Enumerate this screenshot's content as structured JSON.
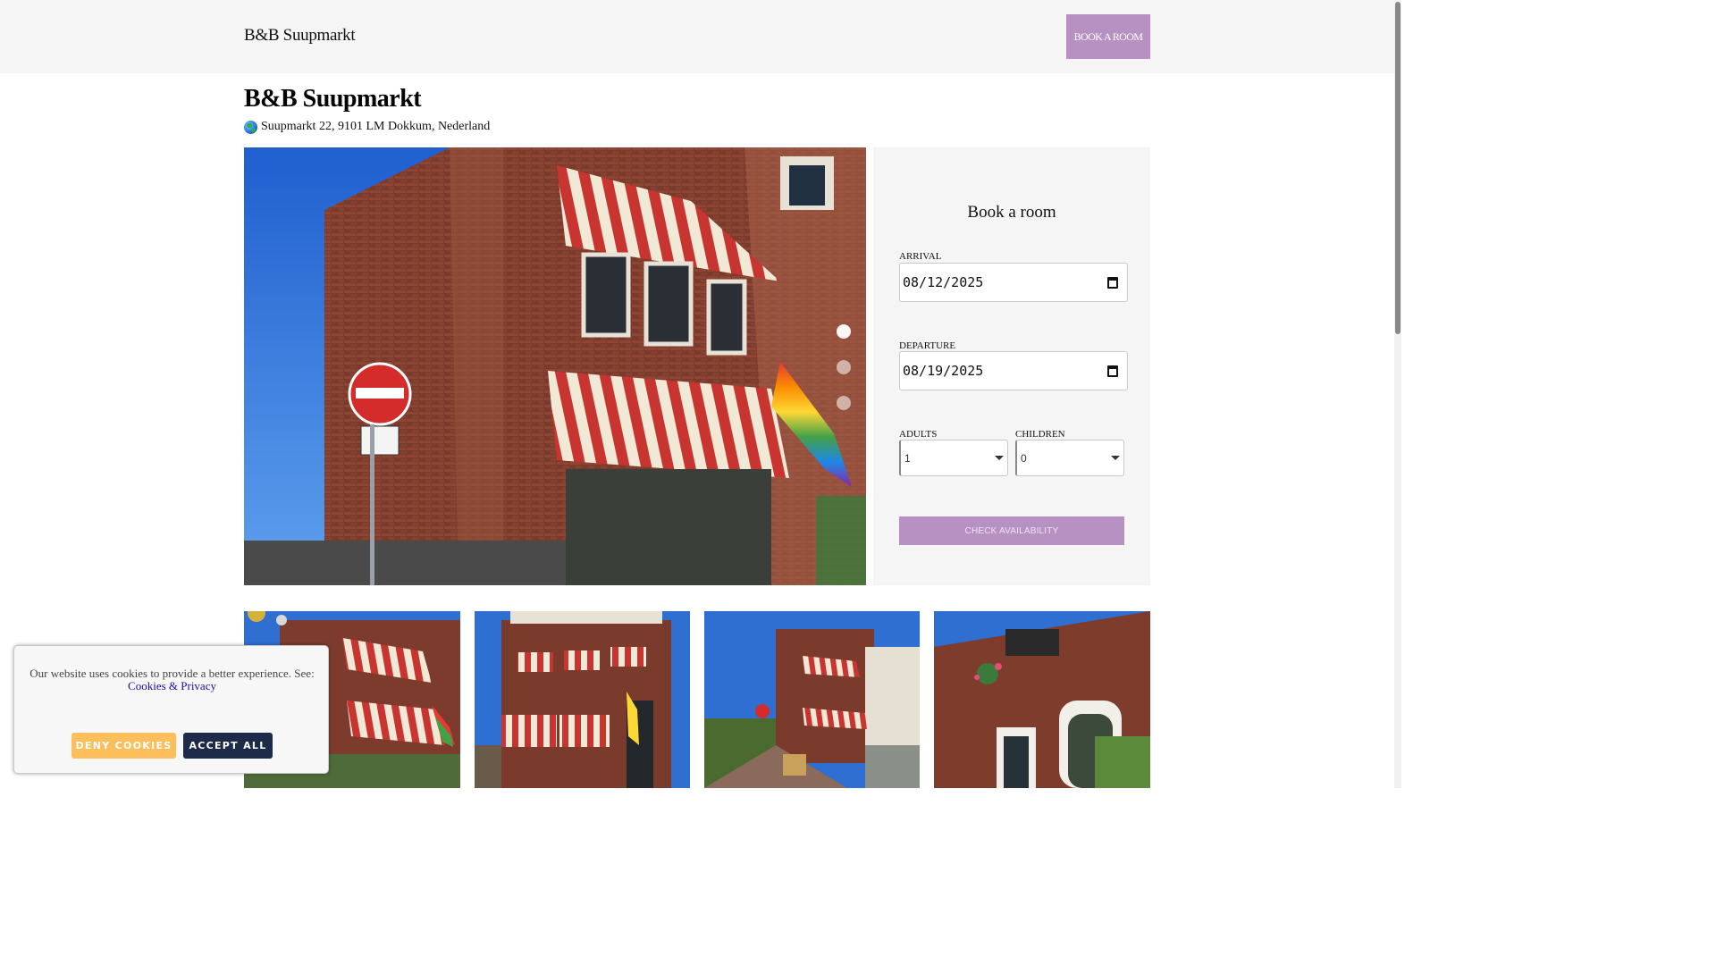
{
  "header": {
    "brand": "B&B Suupmarkt",
    "book_button": "BOOK A ROOM"
  },
  "property": {
    "name": "B&B Suupmarkt",
    "address": "Suupmarkt 22, 9101 LM Dokkum, Nederland"
  },
  "carousel": {
    "active_index": 0,
    "slide_count": 3
  },
  "booking": {
    "title": "Book a room",
    "arrival_label": "ARRIVAL",
    "arrival_value": "08/12/2025",
    "departure_label": "DEPARTURE",
    "departure_value": "08/19/2025",
    "adults_label": "ADULTS",
    "adults_value": "1",
    "children_label": "CHILDREN",
    "children_value": "0",
    "check_button": "CHECK AVAILABILITY"
  },
  "cookie": {
    "message": "Our website uses cookies to provide a better experience. See:",
    "link": "Cookies & Privacy",
    "deny": "DENY COOKIES",
    "accept": "ACCEPT ALL"
  },
  "colors": {
    "accent": "#b791c1",
    "deny": "#fdbe5c",
    "accept": "#1e2a4a"
  }
}
